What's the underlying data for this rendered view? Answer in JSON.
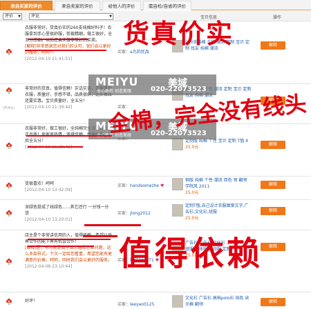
{
  "tabs": [
    "来自买家的评价",
    "来自卖家的评价",
    "给他人的评价",
    "需自检/自省的评价"
  ],
  "filters": {
    "rating": "评价",
    "comment": "评论"
  },
  "columns": {
    "item": "宝贝信息",
    "action": "操作"
  },
  "rows": [
    {
      "comment": "衣服非常好，货真价实的260支纯棉好料子！衣服拿到手心里很舒服，剪裁精细，做工很好，全五分感谢。以后还会来做非常好的买卖。",
      "reply": "[解释]非常感谢您对我们的认可，我们会以更好的服务，呵呵～",
      "date": "[2012-04-10 21:41:51]",
      "buyer": "买家：",
      "buyer_name": "a凡的优品",
      "item": "260支纯棉 个性 潮流 定制 宝贝 定制 找友 纯棉 潮流",
      "price": "",
      "button": "解释"
    },
    {
      "level": "[不评分]",
      "comment": "非常好的货真，值得信赖！实话实说，衣服是好衣服，质量好，手感不错，品质很好，比实体店还要实惠。宝贝质量好，全五分！",
      "reply": "",
      "date": "[2012-04-10 21:39:44]",
      "buyer": "买家：",
      "buyer_name": "",
      "item": "钢版 纯棉 个性 潮流 定制 宝贝 定制 找友 纯棉 潮流",
      "price": "",
      "button": "解释"
    },
    {
      "comment": "衣服非常好，做工很好，全纯棉完全没有线头，正品质！卖家很热情，值得信赖，感谢信赖，最后全五分！",
      "reply": "",
      "date": "[2012-04-10 21:39:43]",
      "buyer": "买家：",
      "buyer_name": "",
      "item": "定制版 纯棉 个性 宝贝 定制 T恤 4",
      "price": "25.0元",
      "button": "解释"
    },
    {
      "comment": "货很喜欢！呵呵",
      "reply": "",
      "date": "[2012-04-10 13:42:09]",
      "buyer": "买家：",
      "buyer_name": "handsomezhe",
      "item": "钢版 纯棉 个性 潮流 双色 领 翻领 学院风 2011",
      "price": "25.0元",
      "button": "解释"
    },
    {
      "comment": "深绿色挺成了线绿色......其它还行 一分钱一分货",
      "reply": "",
      "date": "[2012-04-10 13:20:01]",
      "buyer": "买家：",
      "buyer_name": "jlong2012",
      "item": "定制T恤,自己设计衣服图案文字,广告衫,文化衫,班服",
      "price": "25.0元",
      "button": "解释"
    },
    {
      "comment": "店主是个非常讲信用的人，值得依赖，希望以后再合作的能下再有机会合作！",
      "reply": "[解释]是，有可能是由于显示器和色差问题，这么多款样式，下次一定给您看重，希望您能有更满意的价格，呵呵，同时我们会以更好的服务。",
      "date": "[2012-04-08 23:10:44]",
      "buyer": "买家：",
      "buyer_name": "福仔2008T1",
      "item": "广告衫 广告衫 文化衫 工作服 同学 班服 团体服 运动服 定制",
      "price": "25.0元",
      "button": "解释"
    },
    {
      "comment": "好评！",
      "reply": "",
      "date": "",
      "buyer": "买家：",
      "buyer_name": "leeyao0125",
      "item": "文化衫 广告衫 高档polo衫 纯色 丝光棉 翻领",
      "price": "",
      "button": "解释"
    }
  ],
  "watermark": {
    "brand": "MEIYU",
    "brand_cn": "美域",
    "slogan": "全心助您 创造美丽",
    "phone": "020-22073523"
  },
  "annotations": [
    "货真价实",
    "全棉，完全没有线头",
    "值得依赖"
  ]
}
